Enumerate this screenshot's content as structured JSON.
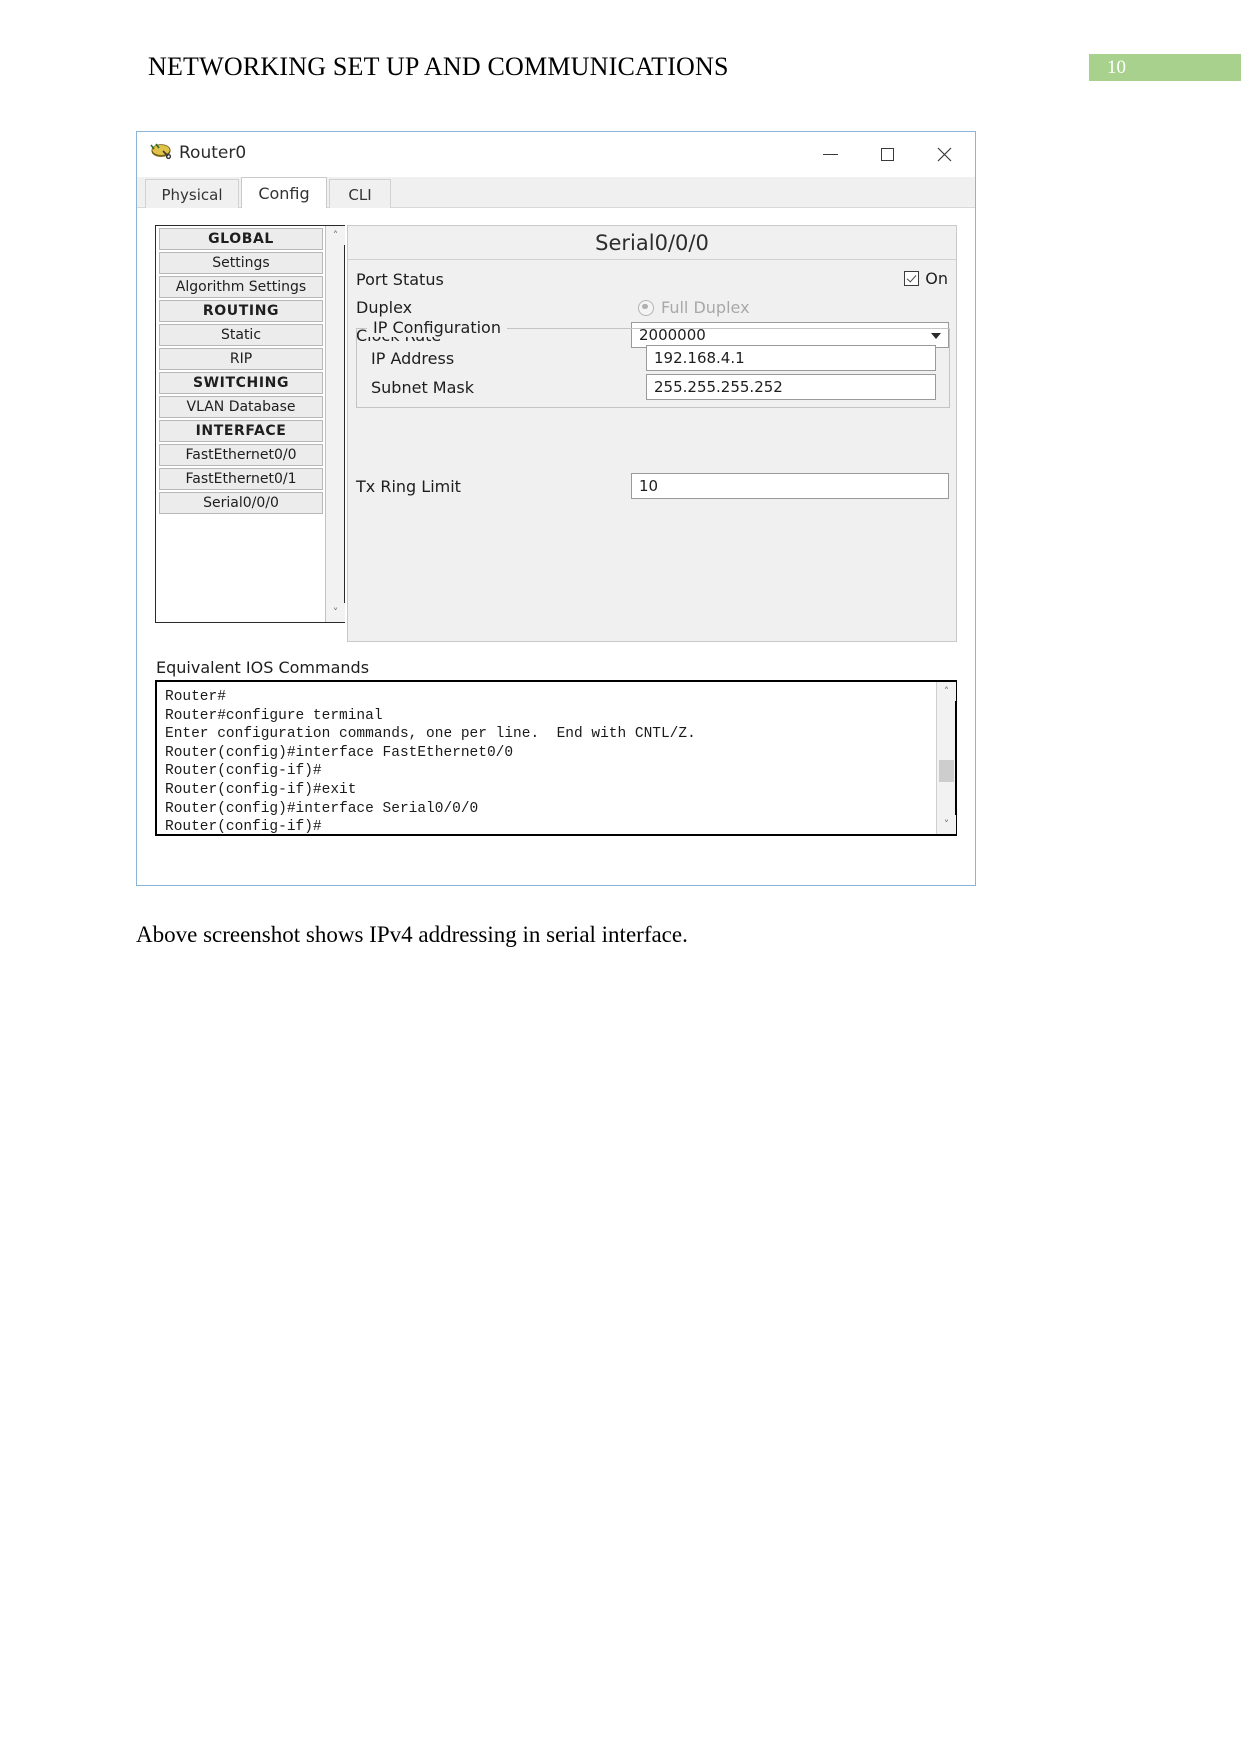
{
  "document": {
    "header_title": "NETWORKING SET UP AND COMMUNICATIONS",
    "page_number": "10",
    "accent_color": "#a9d18e",
    "caption": "Above screenshot shows IPv4 addressing in serial interface."
  },
  "window": {
    "title": "Router0",
    "icon": "router-icon",
    "controls": {
      "minimize": "—",
      "maximize": "□",
      "close": "✕"
    }
  },
  "tabs": [
    {
      "label": "Physical",
      "active": false
    },
    {
      "label": "Config",
      "active": true
    },
    {
      "label": "CLI",
      "active": false
    }
  ],
  "sidebar": {
    "items": [
      {
        "label": "GLOBAL",
        "type": "header"
      },
      {
        "label": "Settings",
        "type": "item"
      },
      {
        "label": "Algorithm Settings",
        "type": "item"
      },
      {
        "label": "ROUTING",
        "type": "header"
      },
      {
        "label": "Static",
        "type": "item"
      },
      {
        "label": "RIP",
        "type": "item"
      },
      {
        "label": "SWITCHING",
        "type": "header"
      },
      {
        "label": "VLAN Database",
        "type": "item"
      },
      {
        "label": "INTERFACE",
        "type": "header"
      },
      {
        "label": "FastEthernet0/0",
        "type": "item"
      },
      {
        "label": "FastEthernet0/1",
        "type": "item"
      },
      {
        "label": "Serial0/0/0",
        "type": "item"
      }
    ],
    "scroll_up": "˄",
    "scroll_down": "˅"
  },
  "detail": {
    "title": "Serial0/0/0",
    "port_status": {
      "label": "Port Status",
      "checkbox_label": "On",
      "checked": true
    },
    "duplex": {
      "label": "Duplex",
      "option_label": "Full Duplex",
      "selected": true,
      "disabled": true
    },
    "clock_rate": {
      "label": "Clock Rate",
      "value": "2000000"
    },
    "ip_configuration": {
      "legend": "IP Configuration",
      "ip_address_label": "IP Address",
      "ip_address_value": "192.168.4.1",
      "subnet_mask_label": "Subnet Mask",
      "subnet_mask_value": "255.255.255.252"
    },
    "tx_ring_limit": {
      "label": "Tx Ring Limit",
      "value": "10"
    }
  },
  "ios": {
    "label": "Equivalent IOS Commands",
    "lines": "Router#\nRouter#configure terminal\nEnter configuration commands, one per line.  End with CNTL/Z.\nRouter(config)#interface FastEthernet0/0\nRouter(config-if)#\nRouter(config-if)#exit\nRouter(config)#interface Serial0/0/0\nRouter(config-if)#",
    "scroll_up": "˄",
    "scroll_down": "˅"
  }
}
